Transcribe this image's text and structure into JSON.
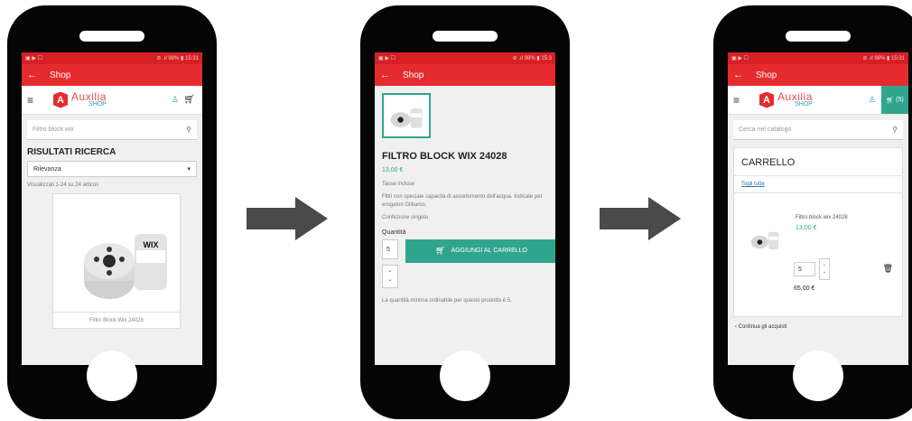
{
  "screens": {
    "list": {
      "status_left": "▣ ▶ ☐",
      "status_right": "⊘ .ıl 98% ▮ 15:31",
      "title": "Shop",
      "logo_main": "Auxilia",
      "logo_sub": "SHOP",
      "search_value": "Filtro block wix",
      "results_heading": "RISULTATI RICERCA",
      "sort_value": "Rilevanza",
      "shown_text": "Visualizzati 1-24 su 24 articoli",
      "product_caption": "Filtro Block Wix 24028",
      "product_brand": "WIX"
    },
    "detail": {
      "status_left": "▣ ▶ ☐",
      "status_right": "⊘ .ıl 98% ▮ 15:3",
      "title": "Shop",
      "product_title": "FILTRO BLOCK WIX 24028",
      "price": "13,00 €",
      "taxes": "Tasse incluse",
      "desc": "Filtri con speciale capacità di assorbimento dell'acqua. Indicate per erogatori Gilbarco.",
      "pack": "Confezione singola",
      "qty_label": "Quantità",
      "qty_value": "5",
      "add_label": "AGGIUNGI AL CARRELLO",
      "min_note": "La quantità minima ordinabile per questo prodotto è 5."
    },
    "cart": {
      "status_left": "▣ ▶ ☐",
      "status_right": "⊘ .ıl 98% ▮ 15:31",
      "title": "Shop",
      "logo_main": "Auxilia",
      "logo_sub": "SHOP",
      "cart_count": "(5)",
      "search_placeholder": "Cerca nel catalogo",
      "cart_title": "CARRELLO",
      "remove_link": "Togli tutte",
      "item_name": "Filtro block wix 24028",
      "item_price": "13,00 €",
      "item_qty": "5",
      "item_total": "65,00 €",
      "continue": "Continua gli acquisti"
    }
  },
  "colors": {
    "red": "#e52b2e",
    "teal": "#2fa58d",
    "phone": "#050505"
  }
}
